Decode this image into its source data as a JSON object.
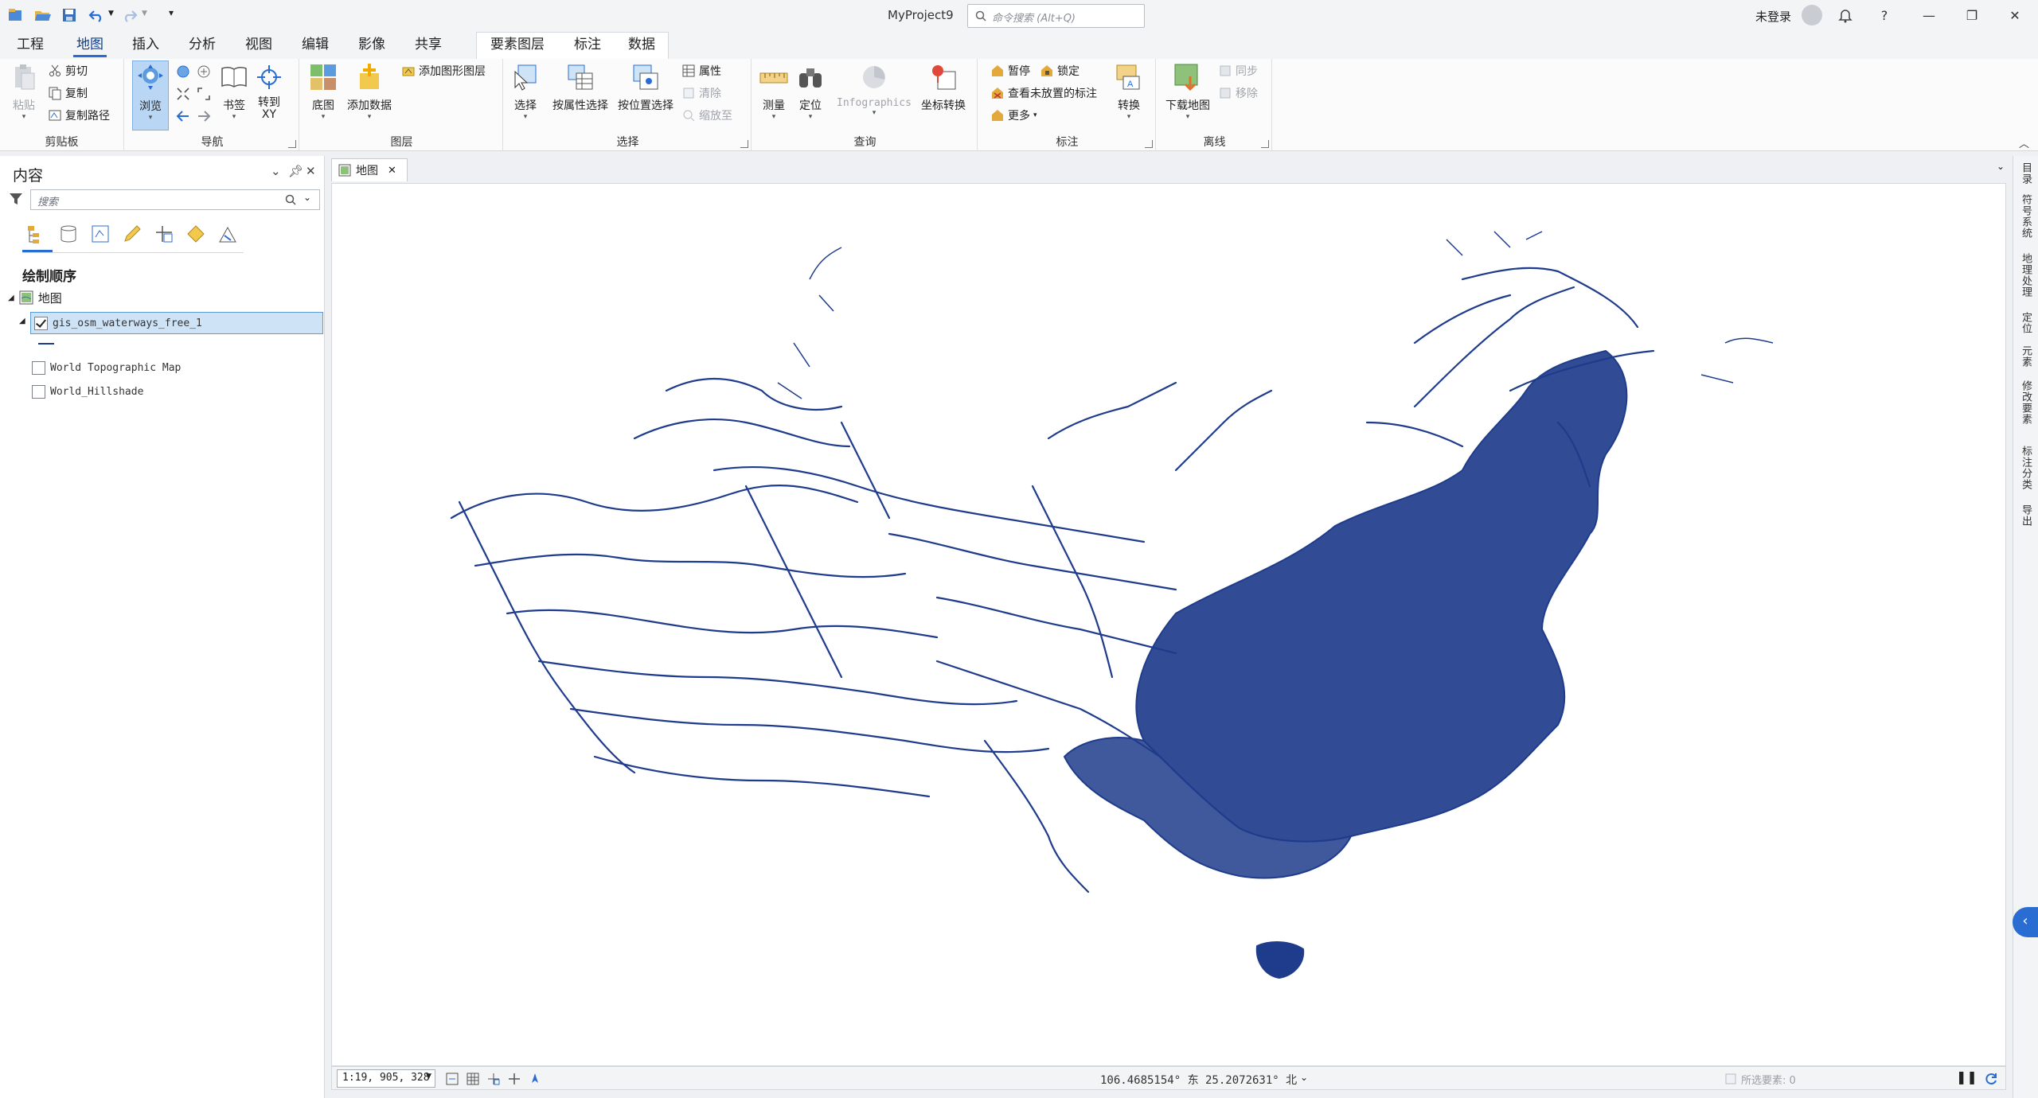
{
  "title_bar": {
    "project": "MyProject9",
    "search_placeholder": "命令搜索 (Alt+Q)",
    "sign_in": "未登录",
    "help": "?"
  },
  "ribbon_tabs": [
    "工程",
    "地图",
    "插入",
    "分析",
    "视图",
    "编辑",
    "影像",
    "共享"
  ],
  "active_tab": "地图",
  "context_tabs": [
    "要素图层",
    "标注",
    "数据"
  ],
  "ribbon": {
    "clipboard": {
      "label": "剪贴板",
      "paste": "粘贴",
      "cut": "剪切",
      "copy": "复制",
      "copy_path": "复制路径"
    },
    "navigate": {
      "label": "导航",
      "explore": "浏览",
      "bookmarks": "书签",
      "go_to_xy": "转到\nXY"
    },
    "layer": {
      "label": "图层",
      "basemap": "底图",
      "add_data": "添加数据",
      "add_graphics": "添加图形图层"
    },
    "selection": {
      "label": "选择",
      "select": "选择",
      "by_attr": "按属性选择",
      "by_loc": "按位置选择",
      "attributes": "属性",
      "clear": "清除",
      "zoom_to": "缩放至"
    },
    "inquiry": {
      "label": "查询",
      "measure": "测量",
      "locate": "定位",
      "infographics": "Infographics",
      "convert_coords": "坐标转换"
    },
    "labeling": {
      "label": "标注",
      "pause": "暂停",
      "lock": "锁定",
      "view_unplaced": "查看未放置的标注",
      "more": "更多",
      "convert": "转换"
    },
    "offline": {
      "label": "离线",
      "download_map": "下载地图",
      "sync": "同步",
      "remove": "移除"
    }
  },
  "contents": {
    "title": "内容",
    "search_placeholder": "搜索",
    "section": "绘制顺序",
    "map_name": "地图",
    "layers": [
      {
        "name": "gis_osm_waterways_free_1",
        "checked": true,
        "selected": true
      },
      {
        "name": "World Topographic Map",
        "checked": false,
        "selected": false
      },
      {
        "name": "World_Hillshade",
        "checked": false,
        "selected": false
      }
    ]
  },
  "map_tab": {
    "label": "地图"
  },
  "status": {
    "scale": "1:19, 905, 328",
    "coordinates": "106.4685154° 东 25.2072631° 北",
    "selected_features": "所选要素: 0"
  },
  "right_rail": [
    "目录",
    "符号系统",
    "地理处理",
    "定位",
    "元素",
    "修改要素",
    "标注分类",
    "导出"
  ],
  "colors": {
    "accent": "#2a6dd2",
    "waterway": "#1f3c8c"
  },
  "icons": [
    "new-project-icon",
    "open-icon",
    "save-icon",
    "undo-icon",
    "redo-icon",
    "search-icon",
    "bell-icon",
    "filter-icon",
    "map-icon",
    "close-icon"
  ]
}
